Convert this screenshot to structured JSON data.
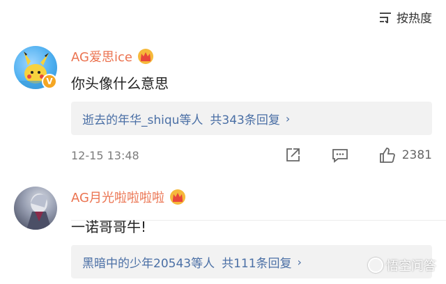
{
  "sort": {
    "label": "按热度",
    "icon": "sort-lines-icon"
  },
  "comments": [
    {
      "username": "AG爱思ice",
      "badge_icon": "crown-badge-icon",
      "verified_icon": "verified-v-icon",
      "text": "你头像什么意思",
      "reply_names": "逝去的年华_shiqu等人",
      "reply_count": "共343条回复",
      "timestamp": "12-15 13:48",
      "like_count": "2381"
    },
    {
      "username": "AG月光啦啦啦啦",
      "badge_icon": "crown-badge-icon",
      "text": "一诺哥哥牛!",
      "reply_names": "黑暗中的少年20543等人",
      "reply_count": "共111条回复"
    }
  ],
  "watermark": {
    "text": "悟空问答"
  },
  "colors": {
    "username": "#eb7350",
    "link": "#4a6fa5",
    "reply_bg": "#f2f2f2"
  }
}
